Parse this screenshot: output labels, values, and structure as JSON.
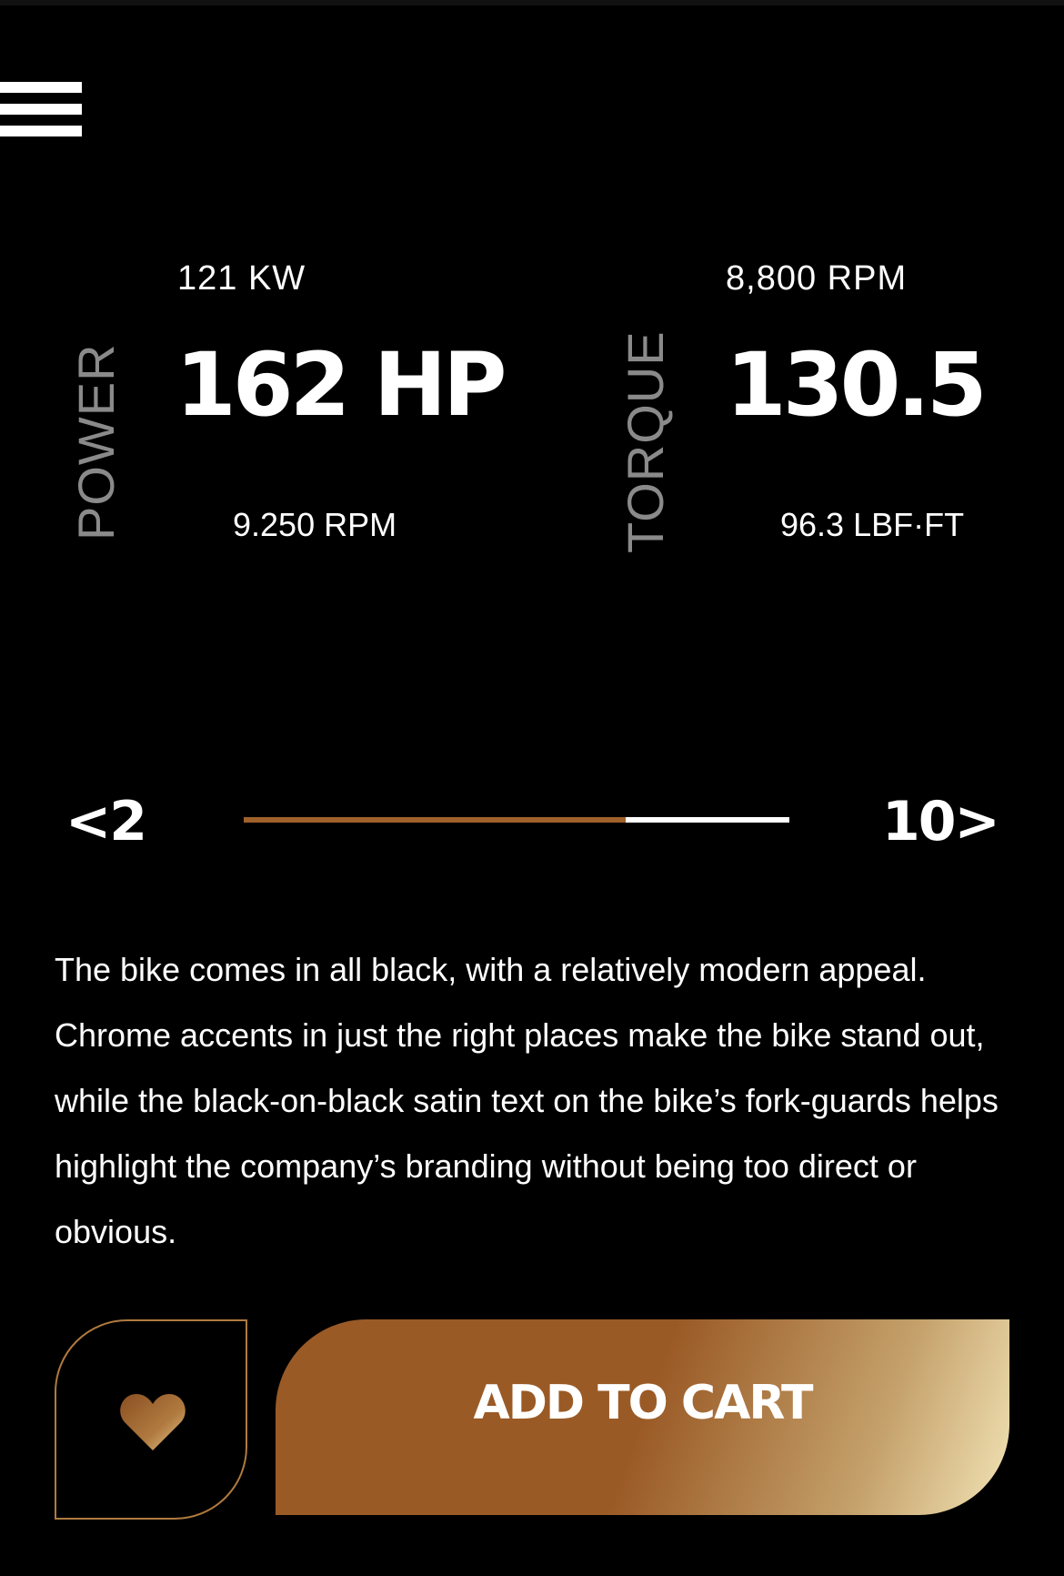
{
  "header": {
    "menu_icon": "hamburger-menu-icon"
  },
  "power": {
    "label": "POWER",
    "kw": "121 KW",
    "value": "162 HP",
    "rpm": "9.250 RPM"
  },
  "torque": {
    "label": "TORQUE",
    "rpm": "8,800 RPM",
    "value": "130.5",
    "lbf": "96.3 LBF·FT"
  },
  "pager": {
    "prev_label": "<2",
    "next_label": "10>",
    "progress": 0.7,
    "progress_color": "#a0612b",
    "track_color": "#ffffff"
  },
  "description": "The bike comes in all black, with a relatively modern appeal. Chrome accents in just the right places make the bike stand out, while the black-on-black satin text on the bike’s fork-guards helps highlight the company’s branding without being too direct or obvious.",
  "actions": {
    "favorite_icon": "heart-icon",
    "add_to_cart_label": "ADD TO CART",
    "accent_color": "#9a5a26"
  }
}
